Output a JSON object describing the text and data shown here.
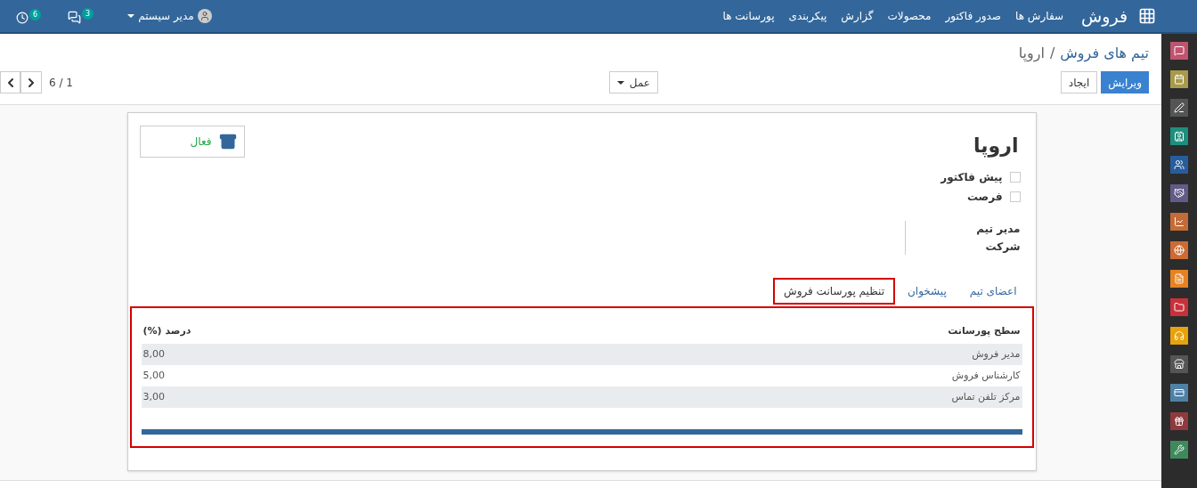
{
  "navbar": {
    "brand": "فروش",
    "menu": [
      "سفارش ها",
      "صدور فاکتور",
      "محصولات",
      "گزارش",
      "پیکربندی",
      "پورسانت ها"
    ],
    "activity_count": "6",
    "message_count": "3",
    "user": "مدیر سیستم"
  },
  "breadcrumb": {
    "parent": "تیم های فروش",
    "separator": "/",
    "current": "اروپا"
  },
  "buttons": {
    "edit": "ویرایش",
    "create": "ایجاد",
    "action": "عمل"
  },
  "pager": "1 / 6",
  "form": {
    "title": "اروپا",
    "status_button": "فعال",
    "checkboxes": [
      {
        "label": "پیش فاکتور",
        "checked": false
      },
      {
        "label": "فرصت",
        "checked": false
      }
    ],
    "fields": [
      "مدیر تیم",
      "شرکت"
    ],
    "tabs": [
      {
        "label": "اعضای تیم",
        "selected": false,
        "highlighted": false
      },
      {
        "label": "پیشخوان",
        "selected": false,
        "highlighted": false
      },
      {
        "label": "تنظیم پورسانت فروش",
        "selected": true,
        "highlighted": true
      }
    ],
    "table": {
      "highlighted": true,
      "columns": [
        "سطح پورسانت",
        "درصد (%)"
      ],
      "rows": [
        [
          "مدیر فروش",
          "8,00"
        ],
        [
          "کارشناس فروش",
          "5,00"
        ],
        [
          "مرکز تلفن تماس",
          "3,00"
        ]
      ]
    }
  },
  "apps": [
    {
      "kind": "chat",
      "color": "#c0546e"
    },
    {
      "kind": "calendar",
      "color": "#a89a4c"
    },
    {
      "kind": "sign",
      "color": "#555555"
    },
    {
      "kind": "contact",
      "color": "#1e8f7d"
    },
    {
      "kind": "team",
      "color": "#285d9c"
    },
    {
      "kind": "handshake",
      "color": "#625b87"
    },
    {
      "kind": "chart",
      "color": "#c46c37"
    },
    {
      "kind": "globe",
      "color": "#cc6b34"
    },
    {
      "kind": "document",
      "color": "#e58324"
    },
    {
      "kind": "folder",
      "color": "#c8313a"
    },
    {
      "kind": "headset",
      "color": "#e4a30f"
    },
    {
      "kind": "store",
      "color": "#555555"
    },
    {
      "kind": "card",
      "color": "#4f81a6"
    },
    {
      "kind": "gift",
      "color": "#8e3a3f"
    },
    {
      "kind": "wrench",
      "color": "#3f8a5d"
    }
  ]
}
